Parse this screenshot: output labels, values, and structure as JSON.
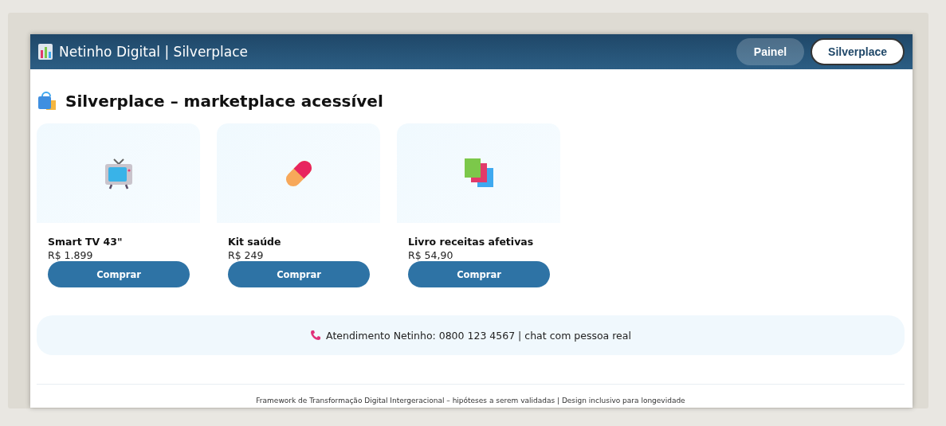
{
  "header": {
    "title": "Netinho Digital | Silverplace",
    "nav": [
      {
        "label": "Painel",
        "selected": false
      },
      {
        "label": "Silverplace",
        "selected": true
      }
    ]
  },
  "page_title": "Silverplace – marketplace acessível",
  "products": [
    {
      "kind": "tv",
      "name": "Smart TV 43\"",
      "price": "R$ 1.899",
      "button": "Comprar"
    },
    {
      "kind": "pill",
      "name": "Kit saúde",
      "price": "R$ 249",
      "button": "Comprar"
    },
    {
      "kind": "books",
      "name": "Livro receitas afetivas",
      "price": "R$ 54,90",
      "button": "Comprar"
    }
  ],
  "support": "Atendimento Netinho: 0800 123 4567 | chat com pessoa real",
  "footer": "Framework de Transformação Digital Intergeracional – hipóteses a serem validadas | Design inclusivo para longevidade"
}
